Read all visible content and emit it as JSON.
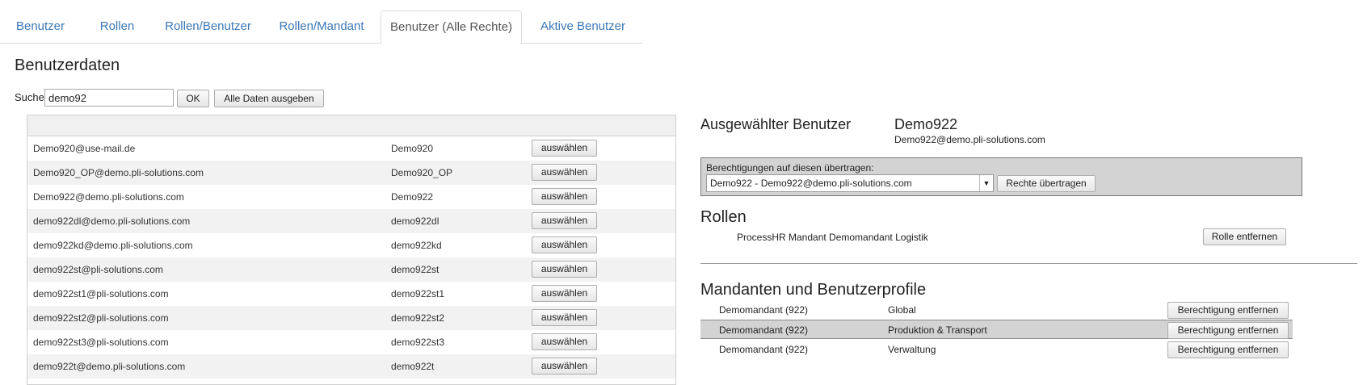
{
  "tabs": [
    {
      "label": "Benutzer",
      "active": false
    },
    {
      "label": "Rollen",
      "active": false
    },
    {
      "label": "Rollen/Benutzer",
      "active": false
    },
    {
      "label": "Rollen/Mandant",
      "active": false
    },
    {
      "label": "Benutzer (Alle Rechte)",
      "active": true
    },
    {
      "label": "Aktive Benutzer",
      "active": false
    }
  ],
  "page_title": "Benutzerdaten",
  "search": {
    "label": "Suche",
    "value": "demo92",
    "ok_label": "OK",
    "all_label": "Alle Daten ausgeben"
  },
  "users": [
    {
      "email": "Demo920@use-mail.de",
      "name": "Demo920",
      "button": "auswählen"
    },
    {
      "email": "Demo920_OP@demo.pli-solutions.com",
      "name": "Demo920_OP",
      "button": "auswählen"
    },
    {
      "email": "Demo922@demo.pli-solutions.com",
      "name": "Demo922",
      "button": "auswählen"
    },
    {
      "email": "demo922dl@demo.pli-solutions.com",
      "name": "demo922dl",
      "button": "auswählen"
    },
    {
      "email": "demo922kd@demo.pli-solutions.com",
      "name": "demo922kd",
      "button": "auswählen"
    },
    {
      "email": "demo922st@pli-solutions.com",
      "name": "demo922st",
      "button": "auswählen"
    },
    {
      "email": "demo922st1@pli-solutions.com",
      "name": "demo922st1",
      "button": "auswählen"
    },
    {
      "email": "demo922st2@pli-solutions.com",
      "name": "demo922st2",
      "button": "auswählen"
    },
    {
      "email": "demo922st3@pli-solutions.com",
      "name": "demo922st3",
      "button": "auswählen"
    },
    {
      "email": "demo922t@demo.pli-solutions.com",
      "name": "demo922t",
      "button": "auswählen"
    }
  ],
  "selected_user": {
    "label": "Ausgewählter Benutzer",
    "name": "Demo922",
    "email": "Demo922@demo.pli-solutions.com"
  },
  "transfer": {
    "label": "Berechtigungen auf diesen übertragen:",
    "selected": "Demo922 - Demo922@demo.pli-solutions.com",
    "button": "Rechte übertragen"
  },
  "roles": {
    "title": "Rollen",
    "items": [
      {
        "name": "ProcessHR Mandant Demomandant Logistik",
        "button": "Rolle entfernen"
      }
    ]
  },
  "mandanten": {
    "title": "Mandanten und Benutzerprofile",
    "rows": [
      {
        "mandant": "Demomandant (922)",
        "profile": "Global",
        "button": "Berechtigung entfernen",
        "highlighted": false
      },
      {
        "mandant": "Demomandant (922)",
        "profile": "Produktion & Transport",
        "button": "Berechtigung entfernen",
        "highlighted": true
      },
      {
        "mandant": "Demomandant (922)",
        "profile": "Verwaltung",
        "button": "Berechtigung entfernen",
        "highlighted": false
      }
    ]
  }
}
